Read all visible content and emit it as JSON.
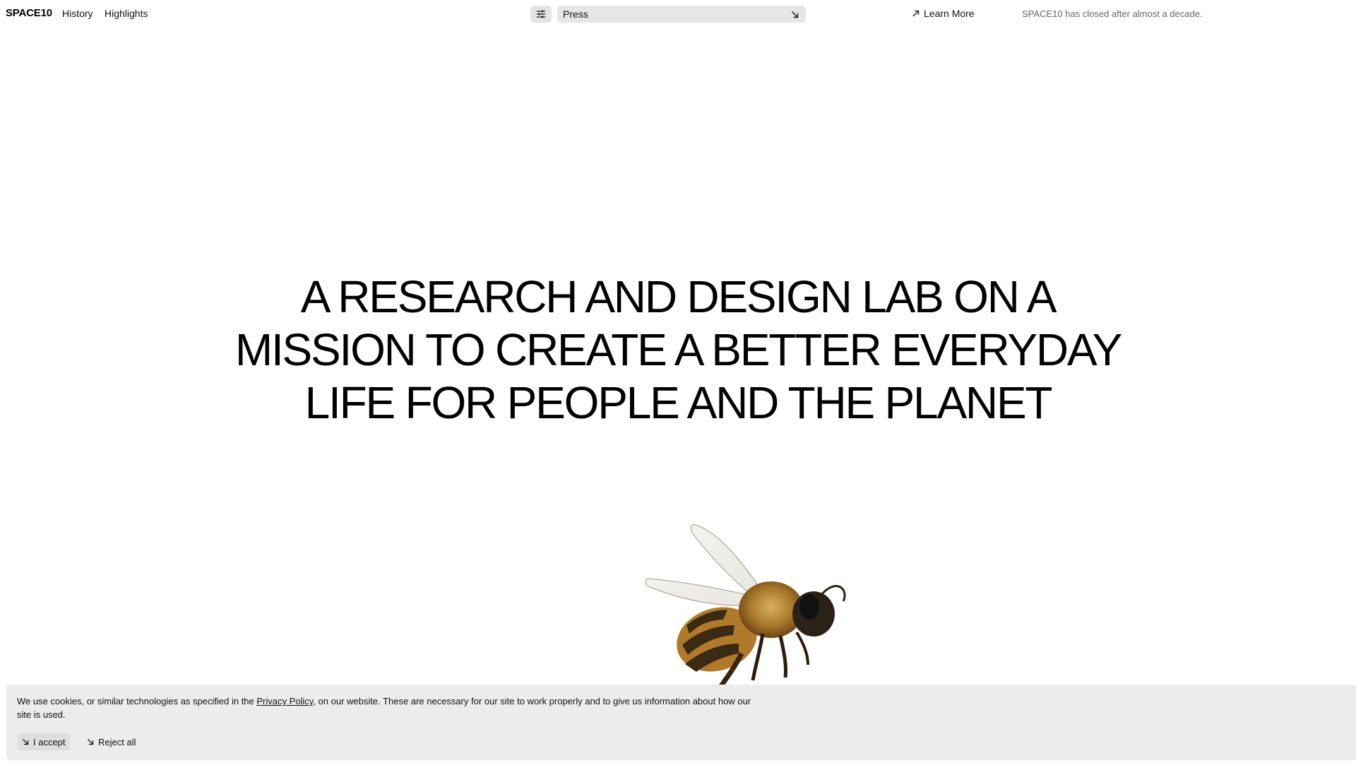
{
  "nav": {
    "logo": "SPACE10",
    "links": [
      {
        "label": "History"
      },
      {
        "label": "Highlights"
      }
    ],
    "filter_icon": "sliders-icon",
    "category_select": {
      "value": "Press",
      "icon": "arrow-down-right-icon"
    },
    "learn_more": {
      "label": "Learn More",
      "icon": "arrow-up-right-icon"
    },
    "notice": "SPACE10 has closed after almost a decade."
  },
  "hero": {
    "lines": [
      "A RESEARCH AND DESIGN LAB ON A",
      "MISSION TO CREATE A BETTER EVERYDAY",
      "LIFE FOR PEOPLE AND THE PLANET"
    ]
  },
  "image": {
    "subject": "bee"
  },
  "cookie_banner": {
    "text_before": "We use cookies, or similar technologies as specified in the ",
    "link": "Privacy Policy",
    "text_after": ", on our website. These are necessary for our site to work properly and to give us information about how our site is used.",
    "accept_label": "I accept",
    "reject_label": "Reject all",
    "button_icon": "arrow-down-right-icon"
  },
  "colors": {
    "text": "#111111",
    "muted": "#666666",
    "control_bg": "#e6e6e6",
    "banner_bg": "#ececec"
  }
}
